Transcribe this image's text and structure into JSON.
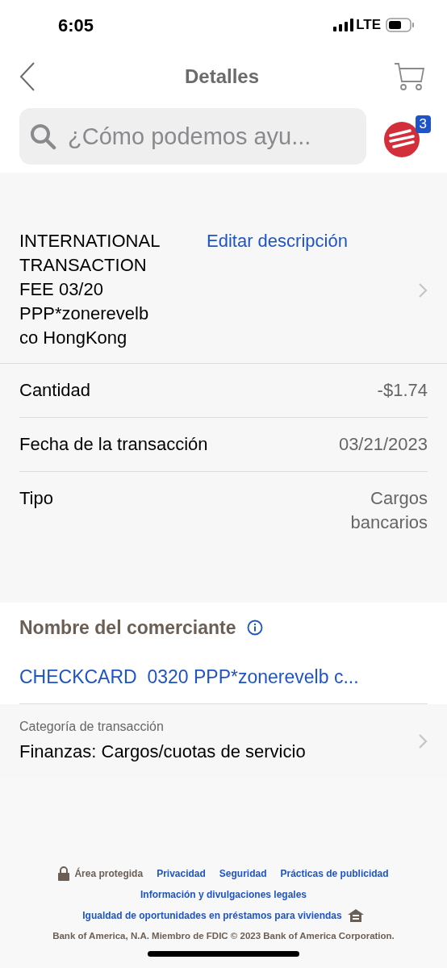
{
  "status_bar": {
    "time": "6:05",
    "network": "LTE"
  },
  "nav": {
    "title": "Detalles"
  },
  "search": {
    "placeholder": "¿Cómo podemos ayu..."
  },
  "assistant": {
    "badge": "3"
  },
  "description": {
    "lines": [
      "INTERNATIONAL",
      "TRANSACTION",
      "FEE 03/20",
      "PPP*zonerevelb",
      "co HongKong"
    ],
    "edit_link": "Editar descripción"
  },
  "details": [
    {
      "label": "Cantidad",
      "value_lines": [
        "-$1.74"
      ]
    },
    {
      "label": "Fecha de la transacción",
      "value_lines": [
        "03/21/2023"
      ]
    },
    {
      "label": "Tipo",
      "value_lines": [
        "Cargos",
        "bancarios"
      ]
    }
  ],
  "merchant": {
    "heading": "Nombre del comerciante",
    "name": "CHECKCARD  0320 PPP*zonerevelb c..."
  },
  "category": {
    "label": "Categoría de transacción",
    "value": "Finanzas: Cargos/cuotas de servicio"
  },
  "footer": {
    "secure": "Área protegida",
    "links_row1": [
      "Privacidad",
      "Seguridad",
      "Prácticas de publicidad"
    ],
    "links_row2": [
      "Información y divulgaciones legales"
    ],
    "housing_link": "Igualdad de oportunidades en préstamos para viviendas",
    "copyright": "Bank of America, N.A. Miembro de FDIC © 2023 Bank of America Corporation."
  }
}
